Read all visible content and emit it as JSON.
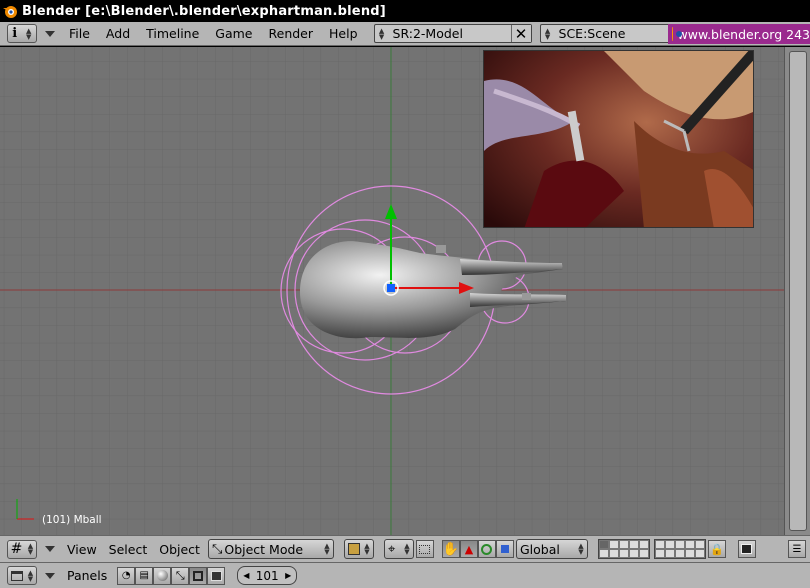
{
  "window": {
    "title": "Blender [e:\\Blender\\.blender\\exphartman.blend]"
  },
  "top_header": {
    "info_icon": "i",
    "menus": [
      "File",
      "Add",
      "Timeline",
      "Game",
      "Render",
      "Help"
    ],
    "screen_field": "SR:2-Model",
    "scene_field": "SCE:Scene",
    "url": "www.blender.org 243"
  },
  "viewport": {
    "object_label": "(101) Mball",
    "overlay_image": "surgical-endoscopy-photo"
  },
  "view_header": {
    "menus": [
      "View",
      "Select",
      "Object"
    ],
    "mode": "Object Mode",
    "orientation": "Global",
    "active_layer": 1
  },
  "buttons_header": {
    "panels_label": "Panels",
    "frame": "101"
  },
  "colors": {
    "viewport_bg": "#737373",
    "header_bg": "#b5b5b5",
    "url_bg": "#9a2a8e",
    "selection": "#e08ae0"
  }
}
